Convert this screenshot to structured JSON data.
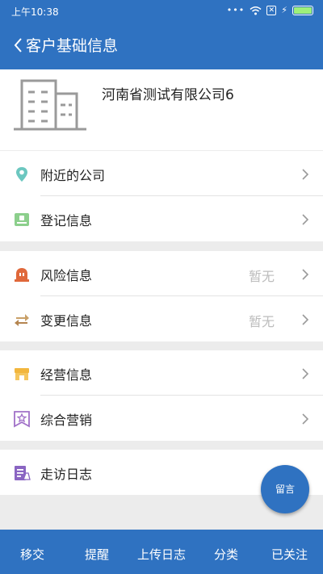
{
  "status_bar": {
    "time": "上午10:38"
  },
  "header": {
    "title": "客户基础信息",
    "back_icon": "chevron-left-icon"
  },
  "company": {
    "name": "河南省测试有限公司6",
    "logo_icon": "building-icon"
  },
  "sections": [
    {
      "rows": [
        {
          "label": "附近的公司",
          "value": "",
          "icon": "location-pin-icon",
          "color": "#6cc7c0"
        },
        {
          "label": "登记信息",
          "value": "",
          "icon": "registration-icon",
          "color": "#8ccf8c"
        }
      ]
    },
    {
      "rows": [
        {
          "label": "风险信息",
          "value": "暂无",
          "icon": "risk-icon",
          "color": "#e0683a"
        },
        {
          "label": "变更信息",
          "value": "暂无",
          "icon": "swap-arrows-icon",
          "color": "#c9a068"
        }
      ]
    },
    {
      "rows": [
        {
          "label": "经营信息",
          "value": "",
          "icon": "store-icon",
          "color": "#f2b63d"
        },
        {
          "label": "综合营销",
          "value": "",
          "icon": "star-badge-icon",
          "color": "#a070c8"
        }
      ]
    },
    {
      "rows": [
        {
          "label": "走访日志",
          "value": "",
          "icon": "visit-log-icon",
          "color": "#8a65c2"
        }
      ]
    }
  ],
  "fab": {
    "label": "留言"
  },
  "bottom_bar": {
    "tabs": [
      "移交",
      "提醒",
      "上传日志",
      "分类",
      "已关注"
    ]
  },
  "colors": {
    "primary": "#2f72c1",
    "background": "#ececec"
  }
}
